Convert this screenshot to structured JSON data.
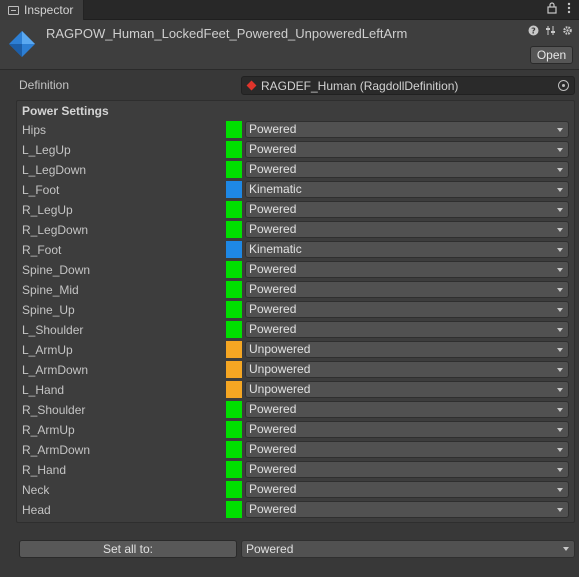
{
  "tab": {
    "title": "Inspector",
    "icons": [
      "lock-icon",
      "more-icon"
    ]
  },
  "header": {
    "asset_name": "RAGPOW_Human_LockedFeet_Powered_UnpoweredLeftArm",
    "open_label": "Open",
    "icons": [
      "help-icon",
      "preset-icon",
      "settings-icon"
    ]
  },
  "definition": {
    "label": "Definition",
    "value": "RAGDEF_Human (RagdollDefinition)"
  },
  "power_settings": {
    "title": "Power Settings",
    "rows": [
      {
        "name": "Hips",
        "mode": "Powered",
        "color": "#00e000"
      },
      {
        "name": "L_LegUp",
        "mode": "Powered",
        "color": "#00e000"
      },
      {
        "name": "L_LegDown",
        "mode": "Powered",
        "color": "#00e000"
      },
      {
        "name": "L_Foot",
        "mode": "Kinematic",
        "color": "#1e88e5"
      },
      {
        "name": "R_LegUp",
        "mode": "Powered",
        "color": "#00e000"
      },
      {
        "name": "R_LegDown",
        "mode": "Powered",
        "color": "#00e000"
      },
      {
        "name": "R_Foot",
        "mode": "Kinematic",
        "color": "#1e88e5"
      },
      {
        "name": "Spine_Down",
        "mode": "Powered",
        "color": "#00e000"
      },
      {
        "name": "Spine_Mid",
        "mode": "Powered",
        "color": "#00e000"
      },
      {
        "name": "Spine_Up",
        "mode": "Powered",
        "color": "#00e000"
      },
      {
        "name": "L_Shoulder",
        "mode": "Powered",
        "color": "#00e000"
      },
      {
        "name": "L_ArmUp",
        "mode": "Unpowered",
        "color": "#f5a623"
      },
      {
        "name": "L_ArmDown",
        "mode": "Unpowered",
        "color": "#f5a623"
      },
      {
        "name": "L_Hand",
        "mode": "Unpowered",
        "color": "#f5a623"
      },
      {
        "name": "R_Shoulder",
        "mode": "Powered",
        "color": "#00e000"
      },
      {
        "name": "R_ArmUp",
        "mode": "Powered",
        "color": "#00e000"
      },
      {
        "name": "R_ArmDown",
        "mode": "Powered",
        "color": "#00e000"
      },
      {
        "name": "R_Hand",
        "mode": "Powered",
        "color": "#00e000"
      },
      {
        "name": "Neck",
        "mode": "Powered",
        "color": "#00e000"
      },
      {
        "name": "Head",
        "mode": "Powered",
        "color": "#00e000"
      }
    ]
  },
  "set_all": {
    "button_label": "Set all to:",
    "value": "Powered"
  }
}
